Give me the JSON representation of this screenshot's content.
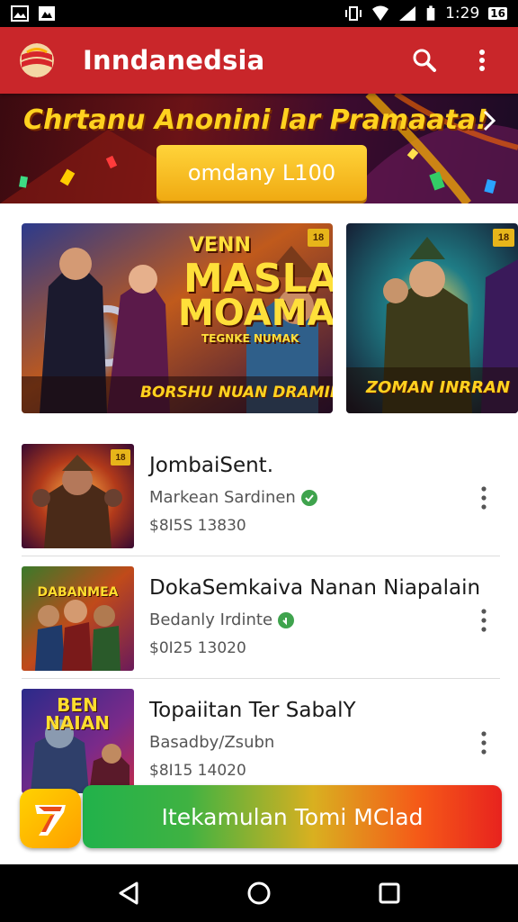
{
  "status_bar": {
    "time": "1:29",
    "signal_badge": "16"
  },
  "app_bar": {
    "title": "Inndanedsia",
    "logo_icon": "flag-logo",
    "actions": [
      "search-icon",
      "more-vert-icon"
    ]
  },
  "promo": {
    "title": "Chrtanu Anonini lar Pramaata!",
    "button_label": "omdany L100",
    "colors": {
      "title": "#ffd21f",
      "button": "#f5b81f"
    }
  },
  "featured": [
    {
      "headline_line1": "VENN",
      "headline_line2": "MASLA",
      "headline_line3": "MOAMA",
      "subline": "TEGNKE NUMAK",
      "bottom_text": "BORSHU NUAN DRAMILUN",
      "tag": "18"
    },
    {
      "bottom_text": "ZOMAN INRRAN",
      "tag": "18"
    }
  ],
  "list": [
    {
      "name": "JombaiSent.",
      "developer": "Markean Sardinen",
      "verified": true,
      "meta": "$8I5S 13830",
      "thumb_title": "",
      "tag": "18"
    },
    {
      "name": "DokaSemkaiva Nanan Niapalain",
      "developer": "Bedanly Irdinte",
      "verified": true,
      "meta": "$0I25 13020",
      "thumb_title": "DABANMEA",
      "tag": ""
    },
    {
      "name": "Topaiitan Ter SabalY",
      "developer": "Basadby/Zsubn",
      "verified": false,
      "meta": "$8I15 14020",
      "thumb_title": "BEN NAIAN",
      "tag": ""
    }
  ],
  "install": {
    "label": "Itekamulan Tomi MClad",
    "colors": {
      "start": "#21b24b",
      "end": "#e8231e"
    }
  },
  "app_colors": {
    "app_bar": "#c9262a",
    "nav_bar": "#000000"
  },
  "nav": [
    "back-icon",
    "home-icon",
    "recents-icon"
  ]
}
